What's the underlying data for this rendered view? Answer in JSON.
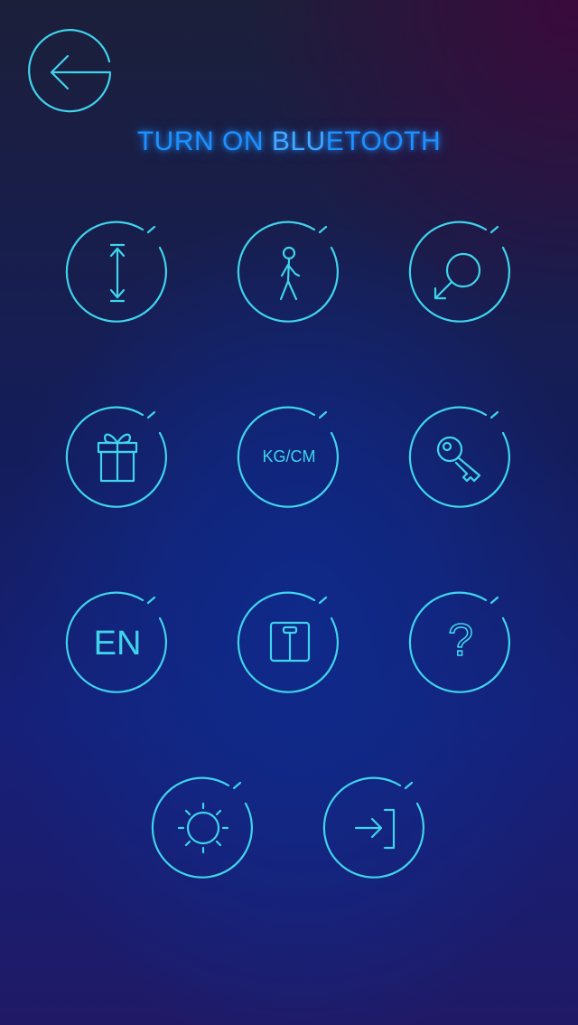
{
  "header": {
    "back_icon": "back-arrow-icon",
    "title_part1": "TURN ON ",
    "title_part2": "BLU",
    "title_part3": "ETOOTH"
  },
  "grid": {
    "height": {
      "icon": "height-arrows-icon"
    },
    "walk": {
      "icon": "walking-person-icon"
    },
    "gender": {
      "icon": "gender-symbol-icon"
    },
    "gift": {
      "icon": "gift-box-icon"
    },
    "units": {
      "icon": "units-text-icon",
      "label": "KG/CM"
    },
    "key": {
      "icon": "key-icon"
    },
    "language": {
      "icon": "language-text-icon",
      "label": "EN"
    },
    "scale": {
      "icon": "bathroom-scale-icon"
    },
    "help": {
      "icon": "question-mark-icon",
      "label": "?"
    },
    "brightness": {
      "icon": "sun-icon"
    },
    "logout": {
      "icon": "exit-door-icon"
    }
  },
  "colors": {
    "accent": "#3fd4ec",
    "title": "#1e90ff",
    "background_top": "#1c1f3a",
    "background_center": "#0f2a8a",
    "background_bottom": "#201a66"
  }
}
